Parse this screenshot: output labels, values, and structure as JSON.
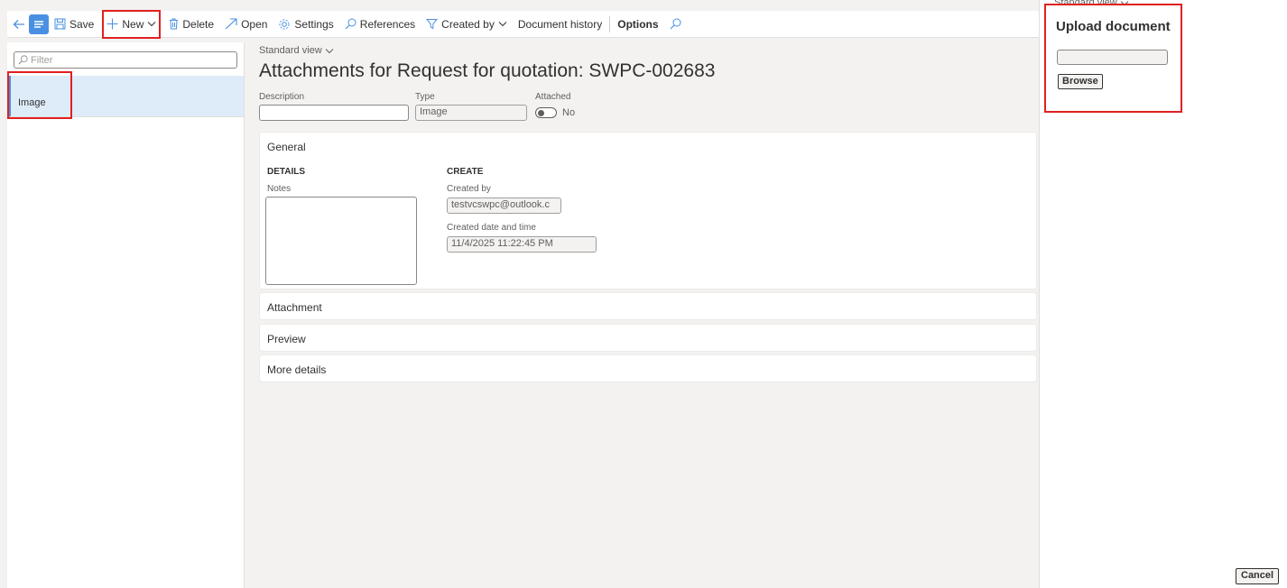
{
  "toolbar": {
    "save_label": "Save",
    "new_label": "New",
    "delete_label": "Delete",
    "open_label": "Open",
    "settings_label": "Settings",
    "references_label": "References",
    "created_by_label": "Created by",
    "document_history_label": "Document history",
    "options_label": "Options"
  },
  "list": {
    "filter_placeholder": "Filter",
    "items": [
      {
        "label": "Image"
      }
    ]
  },
  "main": {
    "view_label": "Standard view",
    "title": "Attachments for Request for quotation: SWPC-002683",
    "header_fields": {
      "description_caption": "Description",
      "description_value": "",
      "type_caption": "Type",
      "type_value": "Image",
      "attached_caption": "Attached",
      "attached_value": "No"
    },
    "sections": {
      "general": {
        "title": "General",
        "details_heading": "DETAILS",
        "notes_caption": "Notes",
        "create_heading": "CREATE",
        "created_by_caption": "Created by",
        "created_by_value": "testvcswpc@outlook.c",
        "created_datetime_caption": "Created date and time",
        "created_datetime_value": "11/4/2025 11:22:45 PM"
      },
      "attachment_title": "Attachment",
      "preview_title": "Preview",
      "more_details_title": "More details"
    }
  },
  "upload_panel": {
    "view_label": "Standard view",
    "title": "Upload document",
    "browse_label": "Browse",
    "cancel_label": "Cancel"
  },
  "colors": {
    "accent": "#4a90e2",
    "highlight_box": "#e02020",
    "selected_row": "#deecf9"
  }
}
